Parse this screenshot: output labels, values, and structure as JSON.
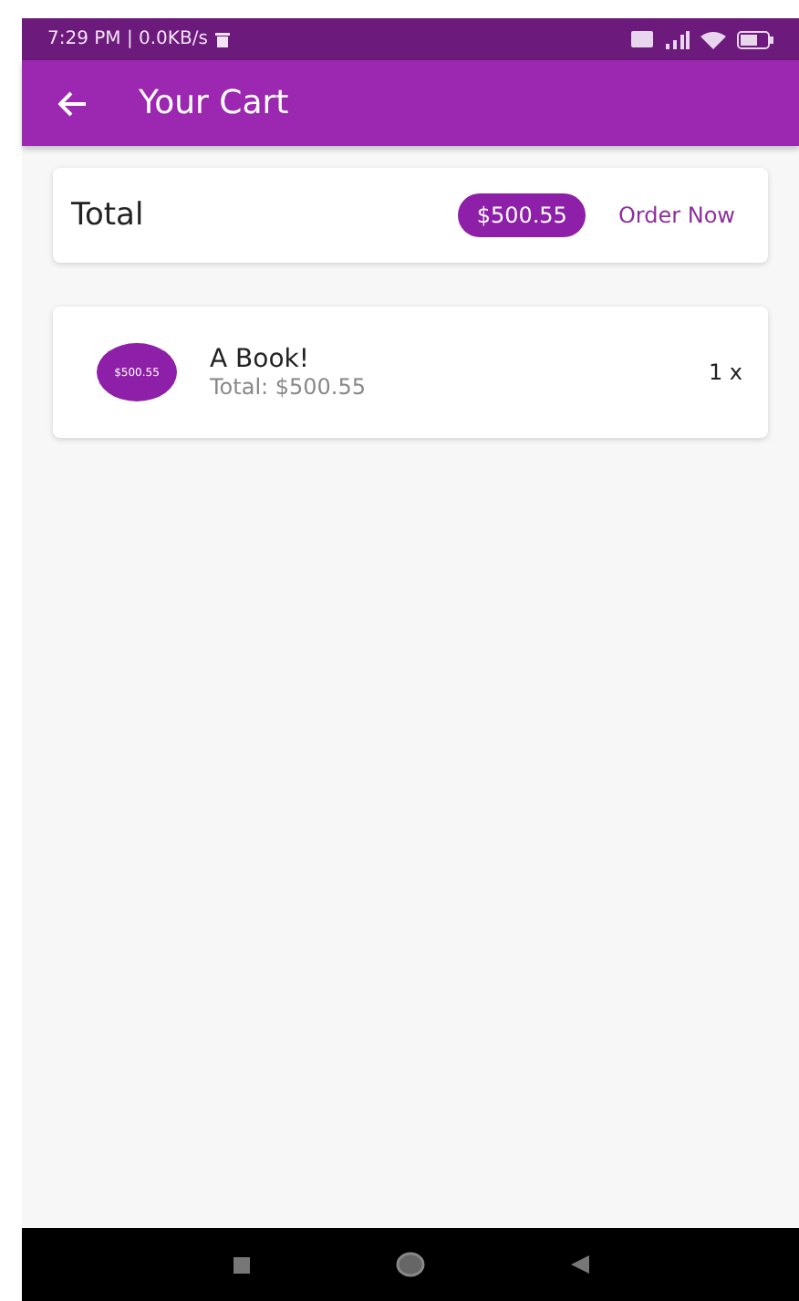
{
  "status_bar": {
    "time": "7:29 PM | 0.0KB/s"
  },
  "app_bar": {
    "title": "Your Cart"
  },
  "summary": {
    "label": "Total",
    "amount": "$500.55",
    "action": "Order Now"
  },
  "items": [
    {
      "avatar": "$500.55",
      "title": "A Book!",
      "subtitle": "Total: $500.55",
      "quantity": "1 x"
    }
  ]
}
